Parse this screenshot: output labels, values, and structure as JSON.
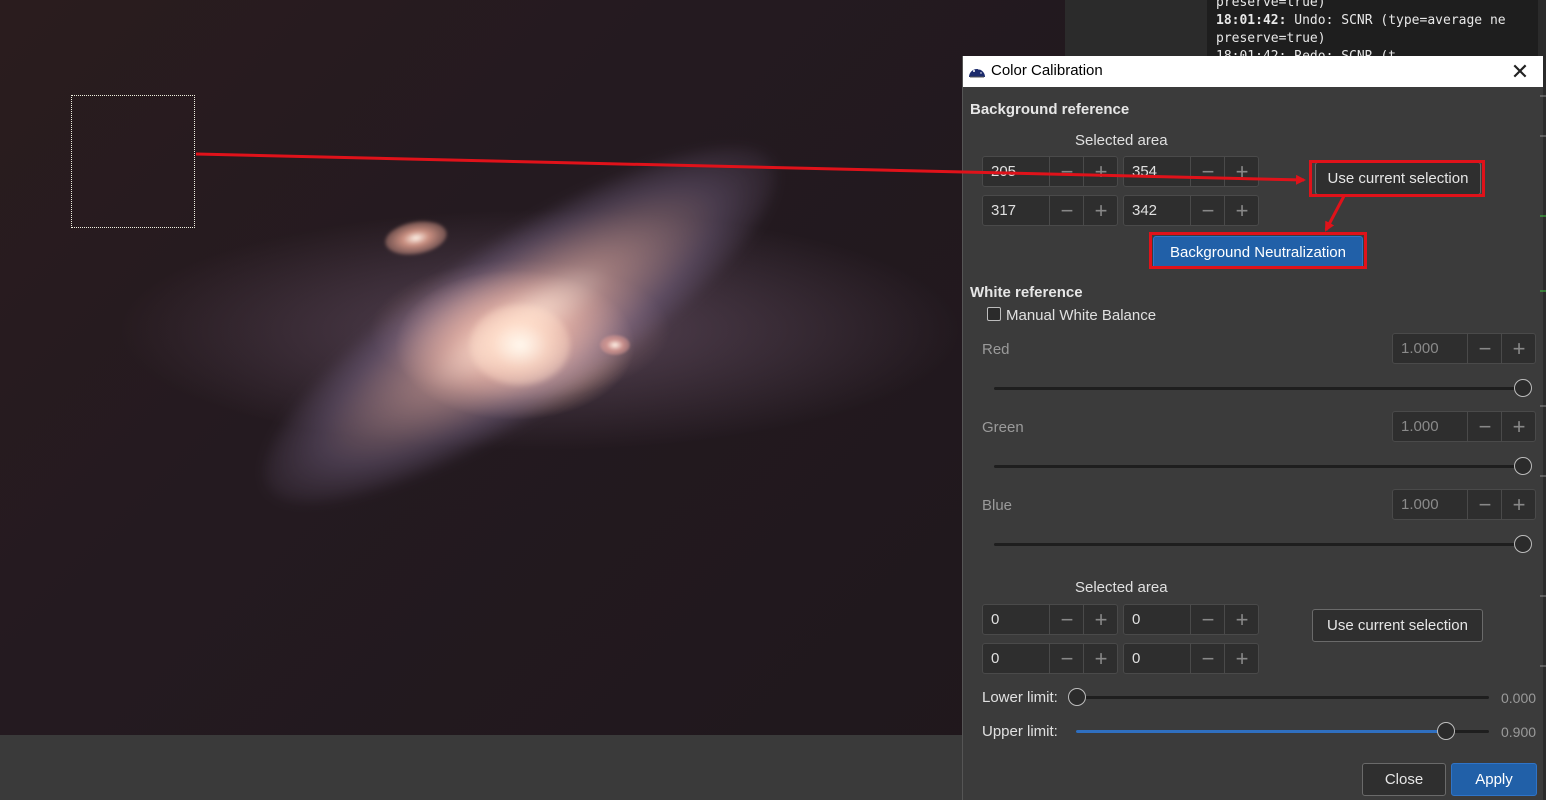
{
  "console": {
    "lines": [
      {
        "ts": "",
        "text": "preserve=true)"
      },
      {
        "ts": "18:01:42:",
        "text": " Undo: SCNR (type=average ne"
      },
      {
        "ts": "",
        "text": "preserve=true)"
      },
      {
        "ts": "",
        "text": "18:01:42: Redo: SCNR (t"
      }
    ]
  },
  "dialog": {
    "title": "Color Calibration",
    "background_reference": {
      "heading": "Background reference",
      "selected_area_label": "Selected area",
      "x": "205",
      "y": "354",
      "w": "317",
      "h": "342",
      "use_selection_label": "Use current selection",
      "neutralize_label": "Background Neutralization"
    },
    "white_reference": {
      "heading": "White reference",
      "manual_wb_label": "Manual White Balance",
      "manual_wb_checked": false,
      "red_label": "Red",
      "red_value": "1.000",
      "green_label": "Green",
      "green_value": "1.000",
      "blue_label": "Blue",
      "blue_value": "1.000",
      "selected_area_label": "Selected area",
      "x": "0",
      "y": "0",
      "w": "0",
      "h": "0",
      "use_selection_label": "Use current selection",
      "lower_limit_label": "Lower limit:",
      "lower_limit_value": "0.000",
      "upper_limit_label": "Upper limit:",
      "upper_limit_value": "0.900"
    },
    "buttons": {
      "close": "Close",
      "apply": "Apply"
    }
  },
  "colors": {
    "annotation": "#e0121a",
    "accent": "#2160a8"
  }
}
